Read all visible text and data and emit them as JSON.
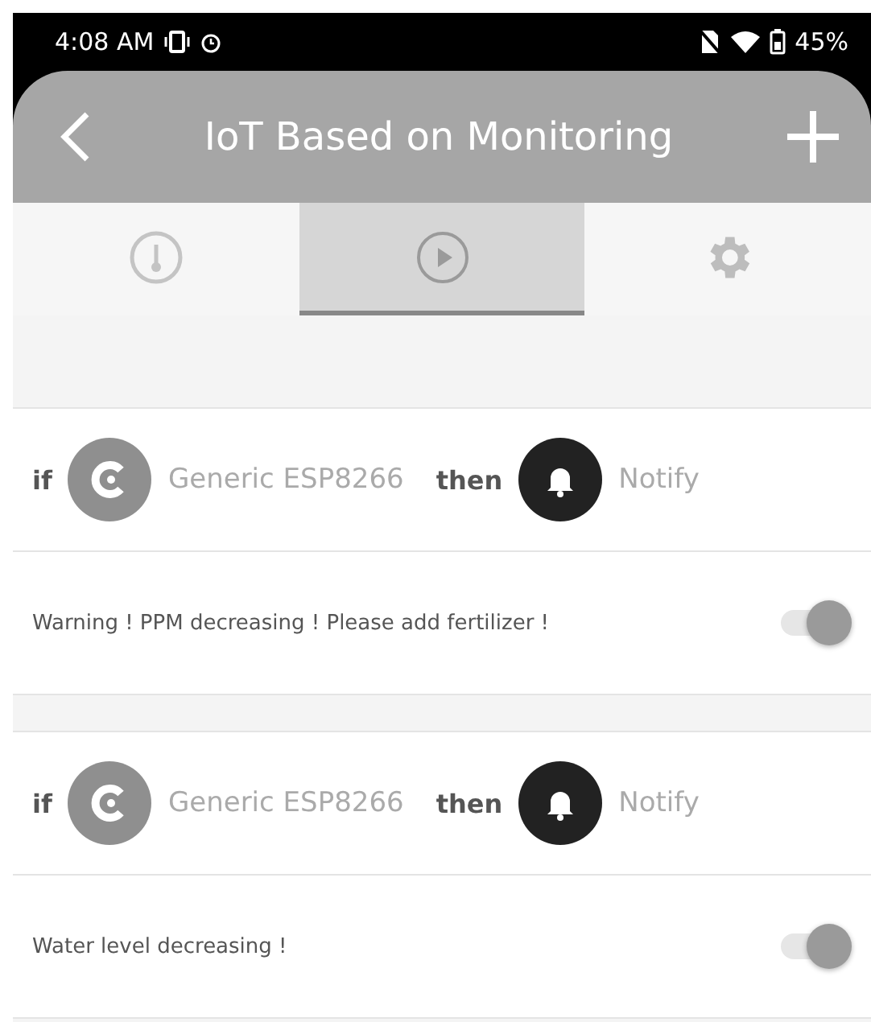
{
  "status_bar": {
    "time": "4:08 AM",
    "battery": "45%"
  },
  "header": {
    "title": "IoT Based on Monitoring"
  },
  "tabs": [
    {
      "kind": "gauge",
      "selected": false
    },
    {
      "kind": "play",
      "selected": true
    },
    {
      "kind": "gear",
      "selected": false
    }
  ],
  "rules": [
    {
      "if": "if",
      "device": "Generic ESP8266",
      "then": "then",
      "action": "Notify",
      "message": "Warning ! PPM decreasing ! Please add fertilizer !",
      "on": true
    },
    {
      "if": "if",
      "device": "Generic ESP8266",
      "then": "then",
      "action": "Notify",
      "message": "Water level decreasing !",
      "on": true
    }
  ]
}
